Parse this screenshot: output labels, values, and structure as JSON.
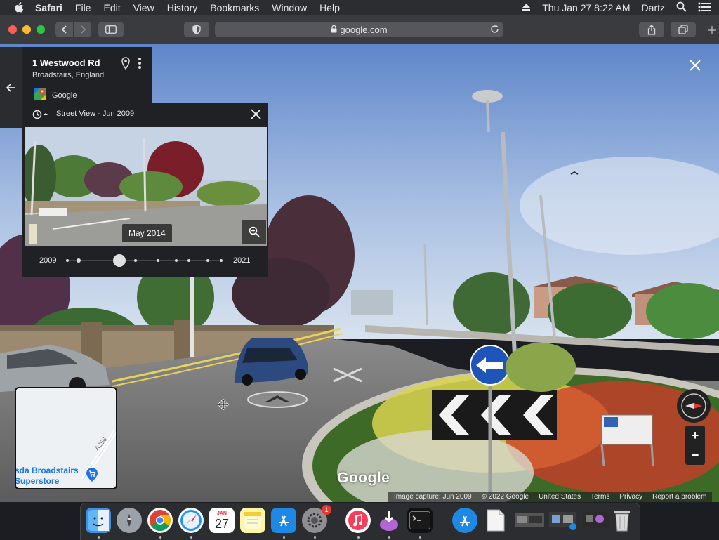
{
  "menubar": {
    "app": "Safari",
    "items": [
      "File",
      "Edit",
      "View",
      "History",
      "Bookmarks",
      "Window",
      "Help"
    ],
    "datetime": "Thu Jan 27  8:22 AM",
    "user": "Dartz"
  },
  "browser": {
    "url": "google.com"
  },
  "place": {
    "title": "1 Westwood Rd",
    "subtitle": "Broadstairs, England",
    "source": "Google"
  },
  "time_machine": {
    "title": "Street View - Jun 2009",
    "selected_date": "May 2014",
    "start_year": "2009",
    "end_year": "2021"
  },
  "minimap": {
    "place_label": "sda Broadstairs Superstore",
    "road_label": "A256"
  },
  "map_controls": {
    "zoom_in": "+",
    "zoom_out": "−"
  },
  "branding": {
    "logo": "Google"
  },
  "attribution": {
    "capture": "Image capture: Jun 2009",
    "copyright": "© 2022 Google",
    "region": "United States",
    "terms": "Terms",
    "privacy": "Privacy",
    "report": "Report a problem"
  },
  "dock": {
    "calendar_month": "JAN",
    "calendar_day": "27",
    "settings_badge": "1"
  }
}
